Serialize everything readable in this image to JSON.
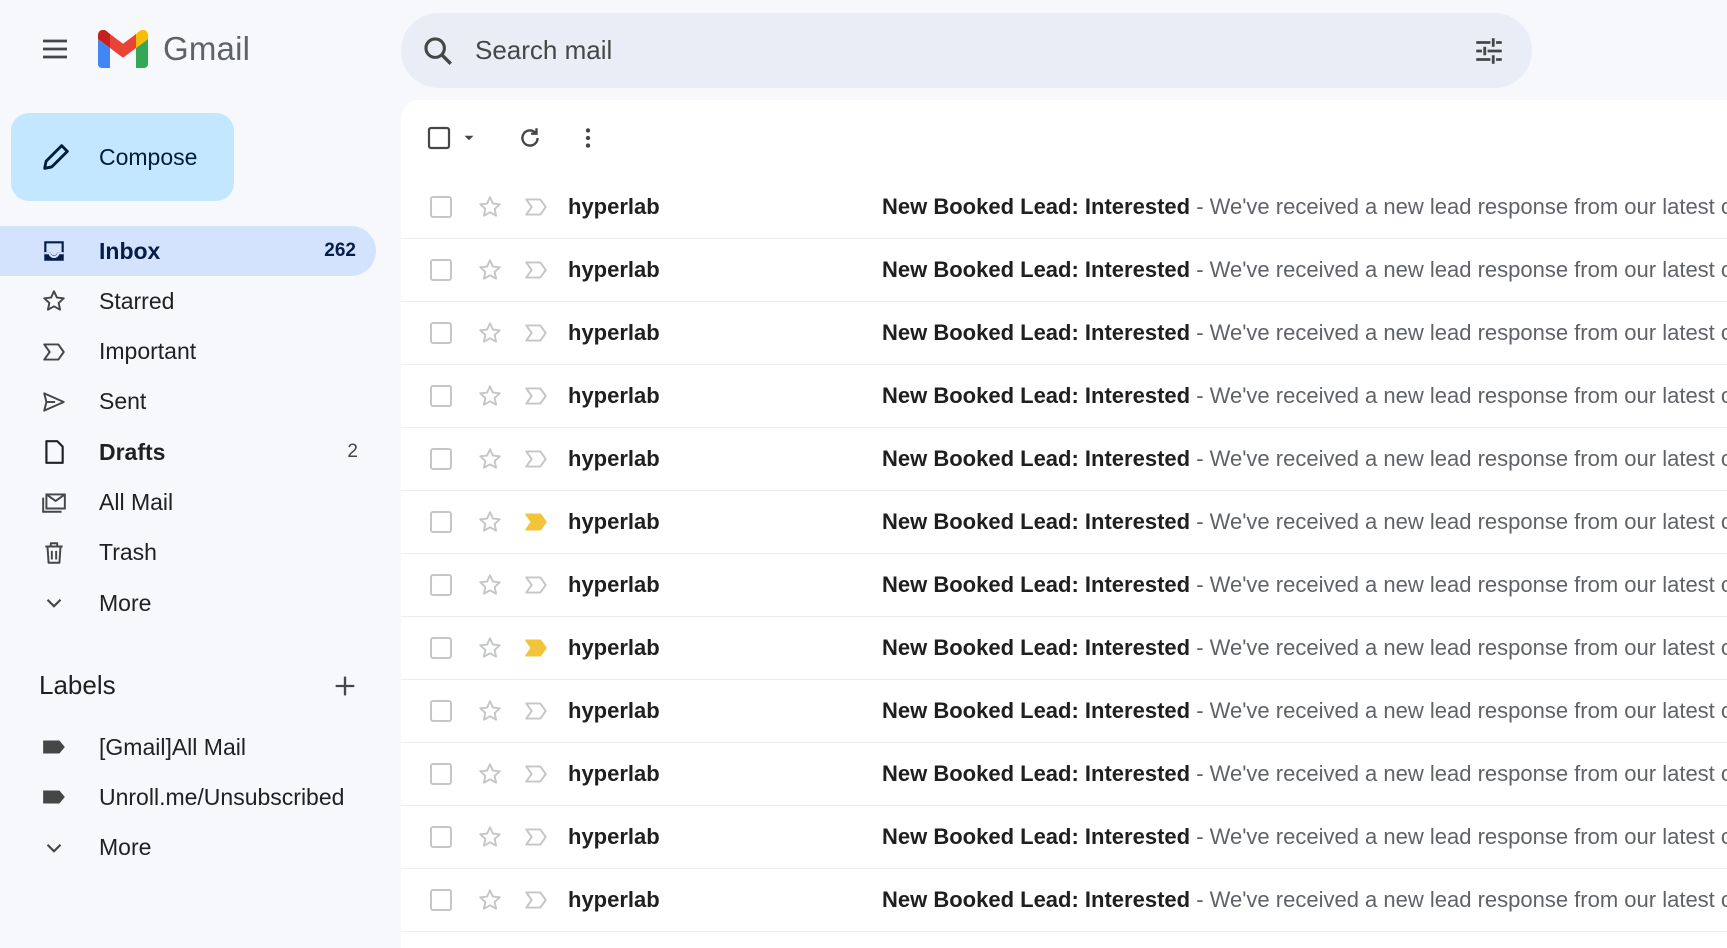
{
  "app": {
    "name": "Gmail"
  },
  "search": {
    "placeholder": "Search mail"
  },
  "compose": {
    "label": "Compose"
  },
  "nav": [
    {
      "label": "Inbox",
      "count": "262",
      "icon": "inbox-icon",
      "active": true
    },
    {
      "label": "Starred",
      "count": "",
      "icon": "star-icon"
    },
    {
      "label": "Important",
      "count": "",
      "icon": "important-icon"
    },
    {
      "label": "Sent",
      "count": "",
      "icon": "send-icon"
    },
    {
      "label": "Drafts",
      "count": "2",
      "icon": "draft-icon",
      "bold": true
    },
    {
      "label": "All Mail",
      "count": "",
      "icon": "all-mail-icon"
    },
    {
      "label": "Trash",
      "count": "",
      "icon": "trash-icon"
    },
    {
      "label": "More",
      "count": "",
      "icon": "chevron-down-icon"
    }
  ],
  "labels": {
    "heading": "Labels",
    "items": [
      {
        "label": "[Gmail]All Mail",
        "icon": "label-icon"
      },
      {
        "label": "Unroll.me/Unsubscribed",
        "icon": "label-icon"
      },
      {
        "label": "More",
        "icon": "chevron-down-icon"
      }
    ]
  },
  "emails": [
    {
      "sender": "hyperlab",
      "subject": "New Booked Lead: Interested",
      "snippet": " - We've received a new lead response from our latest campaign",
      "important": false
    },
    {
      "sender": "hyperlab",
      "subject": "New Booked Lead: Interested",
      "snippet": " - We've received a new lead response from our latest campaign",
      "important": false
    },
    {
      "sender": "hyperlab",
      "subject": "New Booked Lead: Interested",
      "snippet": " - We've received a new lead response from our latest campaign",
      "important": false
    },
    {
      "sender": "hyperlab",
      "subject": "New Booked Lead: Interested",
      "snippet": " - We've received a new lead response from our latest campaign",
      "important": false
    },
    {
      "sender": "hyperlab",
      "subject": "New Booked Lead: Interested",
      "snippet": " - We've received a new lead response from our latest campaign",
      "important": false
    },
    {
      "sender": "hyperlab",
      "subject": "New Booked Lead: Interested",
      "snippet": " - We've received a new lead response from our latest campaign",
      "important": true
    },
    {
      "sender": "hyperlab",
      "subject": "New Booked Lead: Interested",
      "snippet": " - We've received a new lead response from our latest campaign",
      "important": false
    },
    {
      "sender": "hyperlab",
      "subject": "New Booked Lead: Interested",
      "snippet": " - We've received a new lead response from our latest campaign",
      "important": true
    },
    {
      "sender": "hyperlab",
      "subject": "New Booked Lead: Interested",
      "snippet": " - We've received a new lead response from our latest campaign",
      "important": false
    },
    {
      "sender": "hyperlab",
      "subject": "New Booked Lead: Interested",
      "snippet": " - We've received a new lead response from our latest campaign",
      "important": false
    },
    {
      "sender": "hyperlab",
      "subject": "New Booked Lead: Interested",
      "snippet": " - We've received a new lead response from our latest campaign",
      "important": false
    },
    {
      "sender": "hyperlab",
      "subject": "New Booked Lead: Interested",
      "snippet": " - We've received a new lead response from our latest campaign",
      "important": false
    }
  ],
  "colors": {
    "accent": "#c2e7ff",
    "active_nav": "#d3e3fd",
    "important_marker": "#f2c43b"
  }
}
